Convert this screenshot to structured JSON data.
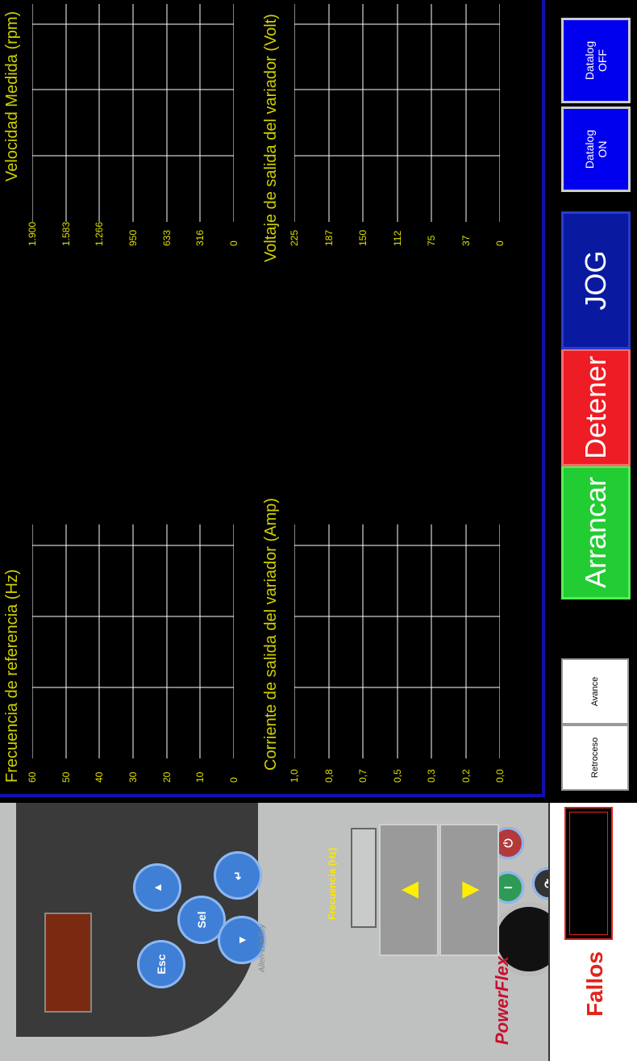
{
  "left_panel": {
    "brand": "PowerFlex",
    "maker": "Allen-Bradley",
    "keys": {
      "esc": "Esc",
      "sel": "Sel"
    },
    "frequency_label": "Frecuencia (Hz)",
    "fallos_title": "Fallos"
  },
  "charts": {
    "top_left": {
      "title": "Frecuencia de referencia (Hz)",
      "ticks": [
        "60",
        "50",
        "40",
        "30",
        "20",
        "10",
        "0"
      ]
    },
    "top_right": {
      "title": "Velocidad Medida (rpm)",
      "ticks": [
        "1.900",
        "1.583",
        "1.266",
        "950",
        "633",
        "316",
        "0"
      ]
    },
    "bottom_left": {
      "title": "Corriente de salida del variador (Amp)",
      "ticks": [
        "1,0",
        "0,8",
        "0,7",
        "0,5",
        "0,3",
        "0,2",
        "0,0"
      ]
    },
    "bottom_right": {
      "title": "Voltaje de salida del variador (Volt)",
      "ticks": [
        "225",
        "187",
        "150",
        "112",
        "75",
        "37",
        "0"
      ]
    }
  },
  "controls": {
    "retroceso": "Retroceso",
    "avance": "Avance",
    "arrancar": "Arrancar",
    "detener": "Detener",
    "jog": "JOG",
    "datalog_on": "Datalog\nON",
    "datalog_off": "Datalog\nOFF"
  },
  "colors": {
    "arrancar": "#22cc33",
    "detener": "#ee1c24",
    "jog": "#0a1aa0",
    "datalog": "#0000ee",
    "chart_text": "#e0e000",
    "fallos": "#e2231a"
  }
}
